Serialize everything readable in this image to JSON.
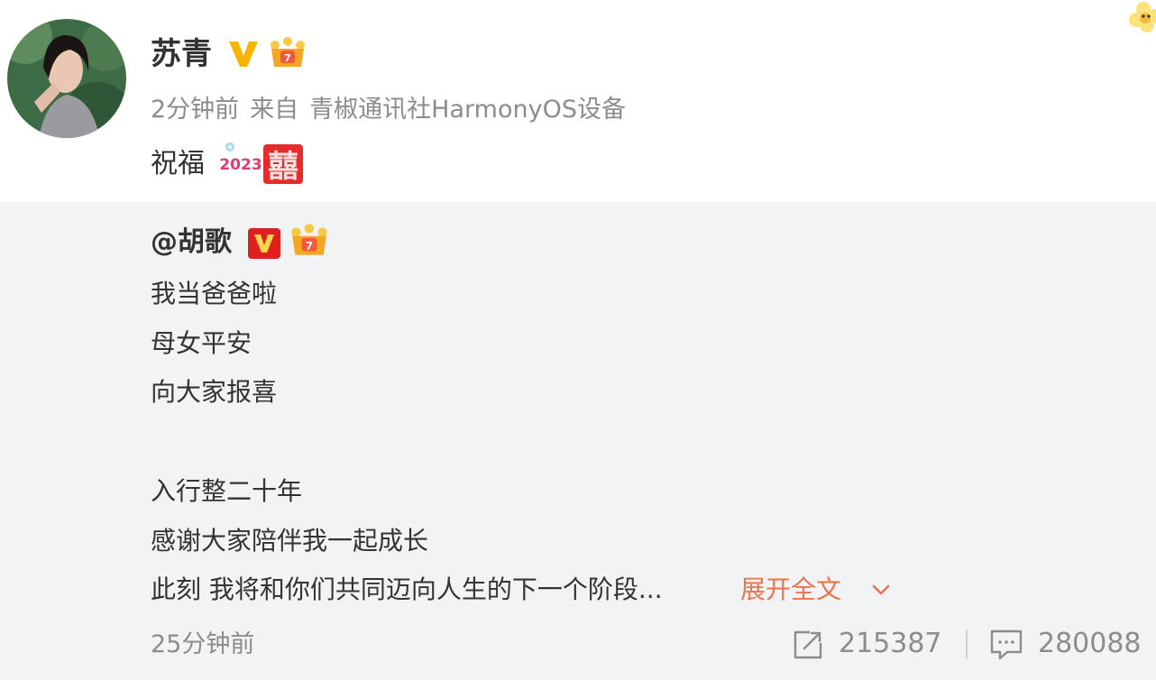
{
  "post": {
    "username": "苏青",
    "meta": {
      "time": "2分钟前",
      "from_label": "来自",
      "device": "青椒通讯社HarmonyOS设备"
    },
    "text": "祝福",
    "badge_year": "2023",
    "emoji": "囍"
  },
  "repost": {
    "mention": "@胡歌",
    "lines": [
      "我当爸爸啦",
      "母女平安",
      "向大家报喜",
      "入行整二十年",
      "感谢大家陪伴我一起成长",
      "此刻 我将和你们共同迈向人生的下一个阶段..."
    ],
    "expand_label": "展开全文",
    "time": "25分钟前",
    "repost_count": "215387",
    "comment_count": "280088"
  },
  "colors": {
    "accent": "#eb7350",
    "muted": "#8c8c8c",
    "repost_bg": "#f2f3f5",
    "verified_gold": "#f7b500",
    "verified_red": "#e02020"
  },
  "icons": [
    "verified-gold-icon",
    "crown-badge-icon",
    "verified-red-icon",
    "chevron-down-icon",
    "repost-icon",
    "comment-icon"
  ]
}
